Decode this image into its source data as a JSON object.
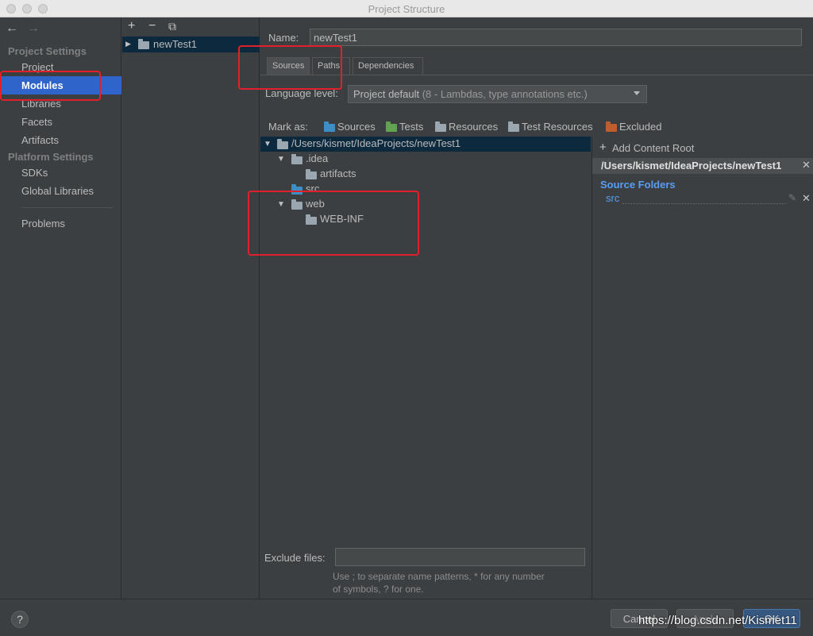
{
  "window": {
    "title": "Project Structure"
  },
  "sidebar": {
    "back": "←",
    "forward": "→",
    "section1": "Project Settings",
    "items1": [
      "Project",
      "Modules",
      "Libraries",
      "Facets",
      "Artifacts"
    ],
    "section2": "Platform Settings",
    "items2": [
      "SDKs",
      "Global Libraries"
    ],
    "items3": [
      "Problems"
    ]
  },
  "modules": {
    "add": "+",
    "remove": "−",
    "copy": "⧉",
    "list": [
      "newTest1"
    ]
  },
  "module": {
    "name_label": "Name:",
    "name_value": "newTest1",
    "tabs": [
      "Sources",
      "Paths",
      "Dependencies"
    ],
    "language_label": "Language level:",
    "language_value": "Project default",
    "language_detail": " (8 - Lambdas, type annotations etc.)",
    "mark_as": "Mark as:",
    "mark_options": [
      "Sources",
      "Tests",
      "Resources",
      "Test Resources",
      "Excluded"
    ]
  },
  "tree": [
    {
      "label": "/Users/kismet/IdeaProjects/newTest1",
      "depth": 0,
      "expanded": true
    },
    {
      "label": ".idea",
      "depth": 1,
      "expanded": true
    },
    {
      "label": "artifacts",
      "depth": 2
    },
    {
      "label": "src",
      "depth": 1,
      "type": "source"
    },
    {
      "label": "web",
      "depth": 1,
      "expanded": true
    },
    {
      "label": "WEB-INF",
      "depth": 2
    }
  ],
  "content_root": {
    "add_label": "Add Content Root",
    "path": "/Users/kismet/IdeaProjects/newTest1",
    "source_folders_label": "Source Folders",
    "source_folders": [
      "src"
    ]
  },
  "exclude": {
    "label": "Exclude files:",
    "value": "",
    "hint1": "Use ; to separate name patterns, * for any number",
    "hint2": "of symbols, ? for one."
  },
  "footer": {
    "help": "?",
    "cancel": "Cancel",
    "apply": "Apply",
    "ok": "OK",
    "watermark": "https://blog.csdn.net/Kismet11"
  },
  "colors": {
    "selection": "#2f65ca",
    "annotation": "#e0202a",
    "link": "#589df6"
  }
}
